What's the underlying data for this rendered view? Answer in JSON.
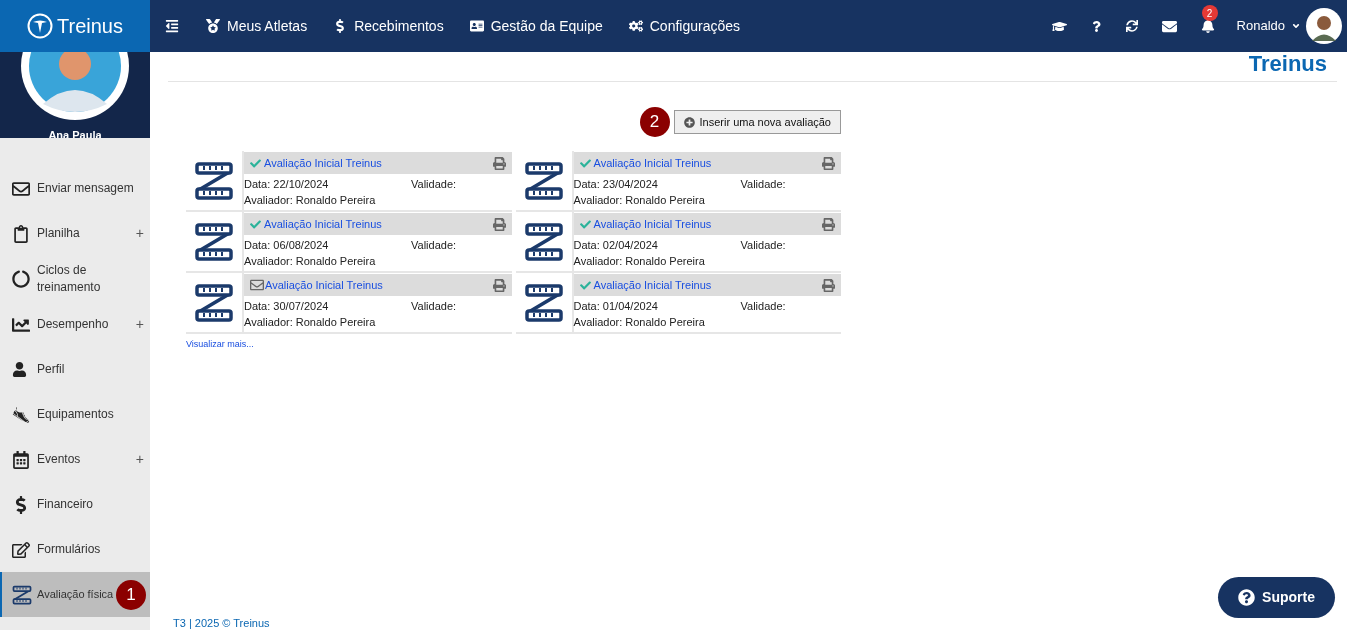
{
  "header": {
    "logo": "Treinus",
    "nav": [
      {
        "label": "Meus Atletas"
      },
      {
        "label": "Recebimentos"
      },
      {
        "label": "Gestão da Equipe"
      },
      {
        "label": "Configurações"
      }
    ],
    "notification_count": "2",
    "user_name": "Ronaldo"
  },
  "sidebar": {
    "profile_name": "Ana Paula",
    "items": [
      {
        "label": "Enviar mensagem",
        "selected": false
      },
      {
        "label": "Planilha",
        "toggle": "+",
        "selected": false
      },
      {
        "label": "Ciclos de treinamento",
        "selected": false
      },
      {
        "label": "Desempenho",
        "toggle": "+",
        "selected": false
      },
      {
        "label": "Perfil",
        "selected": false
      },
      {
        "label": "Equipamentos",
        "selected": false
      },
      {
        "label": "Eventos",
        "toggle": "+",
        "selected": false
      },
      {
        "label": "Financeiro",
        "selected": false
      },
      {
        "label": "Formulários",
        "selected": false
      },
      {
        "label": "Avaliação física",
        "selected": true,
        "marker": "1"
      }
    ]
  },
  "content": {
    "brand": "Treinus",
    "add_button": {
      "label": "Inserir uma nova avaliação",
      "marker": "2"
    },
    "evaluations": [
      {
        "title": "Avaliação Inicial Treinus",
        "kind": "check",
        "date": "Data: 22/10/2024",
        "validity": "Validade:",
        "evaluator": "Avaliador: Ronaldo Pereira"
      },
      {
        "title": "Avaliação Inicial Treinus",
        "kind": "check",
        "date": "Data: 23/04/2024",
        "validity": "Validade:",
        "evaluator": "Avaliador: Ronaldo Pereira"
      },
      {
        "title": "Avaliação Inicial Treinus",
        "kind": "check",
        "date": "Data: 06/08/2024",
        "validity": "Validade:",
        "evaluator": "Avaliador: Ronaldo Pereira"
      },
      {
        "title": "Avaliação Inicial Treinus",
        "kind": "check",
        "date": "Data: 02/04/2024",
        "validity": "Validade:",
        "evaluator": "Avaliador: Ronaldo Pereira"
      },
      {
        "title": "Avaliação Inicial Treinus",
        "kind": "mail",
        "date": "Data: 30/07/2024",
        "validity": "Validade:",
        "evaluator": "Avaliador: Ronaldo Pereira"
      },
      {
        "title": "Avaliação Inicial Treinus",
        "kind": "check",
        "date": "Data: 01/04/2024",
        "validity": "Validade:",
        "evaluator": "Avaliador: Ronaldo Pereira"
      }
    ],
    "more_link": "Visualizar mais...",
    "footer": "T3 | 2025 © Treinus"
  },
  "support_button": "Suporte"
}
